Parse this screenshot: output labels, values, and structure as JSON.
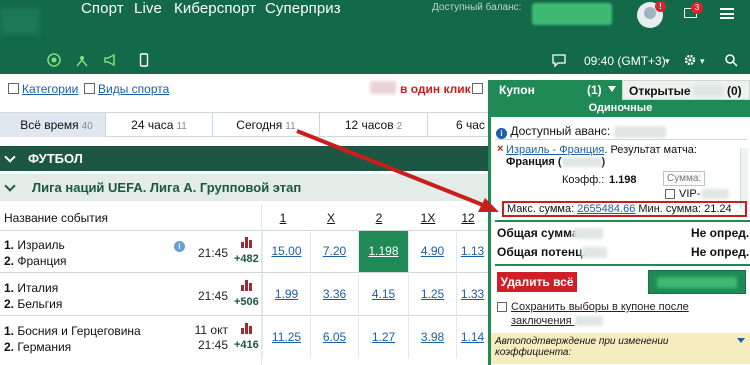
{
  "header": {
    "nav": [
      "Спорт",
      "Live",
      "Киберспорт",
      "Суперприз"
    ],
    "balance_label": "Доступный баланс:",
    "avatar_badge": "!",
    "mail_badge": "3"
  },
  "toolbar": {
    "time_label": "09:40 (GMT+3)",
    "time_caret": "▾",
    "gear_caret": "▾"
  },
  "filters": {
    "categories": "Категории",
    "sports": "Виды спорта",
    "one_click": "в один клик"
  },
  "time_tabs": [
    {
      "label": "Всё время",
      "count": "40"
    },
    {
      "label": "24 часа",
      "count": "11"
    },
    {
      "label": "Сегодня",
      "count": "11"
    },
    {
      "label": "12 часов",
      "count": "2"
    },
    {
      "label": "6 час",
      "count": ""
    }
  ],
  "sport": {
    "title": "ФУТБОЛ"
  },
  "league": {
    "title": "Лига наций UEFA. Лига А. Групповой этап"
  },
  "columns": {
    "event_name": "Название события",
    "c1": "1",
    "cx": "X",
    "c2": "2",
    "c1x": "1X",
    "c12": "12"
  },
  "events": [
    {
      "num1": "1.",
      "team1": "Израиль",
      "num2": "2.",
      "team2": "Франция",
      "date": "",
      "time": "21:45",
      "more": "+482",
      "odds": [
        "15.00",
        "7.20",
        "1.198",
        "4.90",
        "1.13"
      ]
    },
    {
      "num1": "1.",
      "team1": "Италия",
      "num2": "2.",
      "team2": "Бельгия",
      "date": "",
      "time": "21:45",
      "more": "+506",
      "odds": [
        "1.99",
        "3.36",
        "4.15",
        "1.25",
        "1.33"
      ]
    },
    {
      "num1": "1.",
      "team1": "Босния и Герцеговина",
      "num2": "2.",
      "team2": "Германия",
      "date": "11 окт",
      "time": "21:45",
      "more": "+416",
      "odds": [
        "11.25",
        "6.05",
        "1.27",
        "3.98",
        "1.14"
      ]
    }
  ],
  "coupon": {
    "tab_coupon": "Купон",
    "tab_coupon_count": "(1)",
    "tab_open": "Открытые",
    "tab_open_count": "(0)",
    "single": "Одиночные",
    "available_advance": "Доступный аванс:",
    "bet_event": "Израиль - Франция",
    "bet_market": ". Результат матча:",
    "bet_pick": "Франция (",
    "bet_pick_close": ")",
    "coef_label": "Коэфф.:",
    "coef_value": "1.198",
    "sum_placeholder": "Сумма:",
    "vip_label": "VIP-",
    "max_label": "Макс. сумма:",
    "max_value": "2655484.66",
    "min_label": "Мин. сумма:",
    "min_value": "21.24",
    "total_label": "Общая сумма",
    "total_value": "Не опред.",
    "potential_label": "Общая потенц.",
    "potential_value": "Не опред.",
    "delete_all": "Удалить всё",
    "save_choices": "Сохранить выборы в купоне после заключения",
    "auto_confirm": "Автоподтверждение при изменении коэффициента:"
  },
  "colors": {
    "header": "#126a48",
    "accent": "#1f8a55",
    "selected_odd": "#1f8a55",
    "danger": "#d02027"
  }
}
